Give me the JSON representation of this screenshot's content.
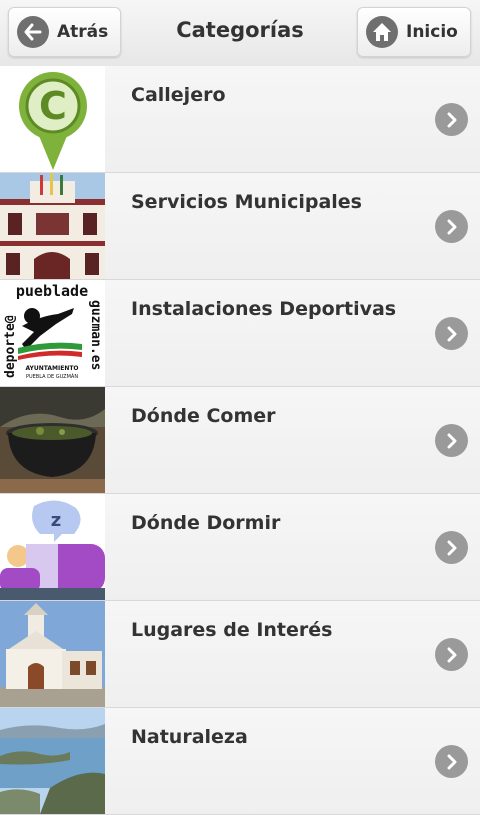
{
  "header": {
    "title": "Categorías",
    "back_label": "Atrás",
    "home_label": "Inicio"
  },
  "categories": [
    {
      "label": "Callejero",
      "icon": "callejero-logo"
    },
    {
      "label": "Servicios Municipales",
      "icon": "town-hall-photo"
    },
    {
      "label": "Instalaciones Deportivas",
      "icon": "deportes-logo"
    },
    {
      "label": "Dónde Comer",
      "icon": "cooking-pot-photo"
    },
    {
      "label": "Dónde Dormir",
      "icon": "sleeping-person-icon"
    },
    {
      "label": "Lugares de Interés",
      "icon": "church-photo"
    },
    {
      "label": "Naturaleza",
      "icon": "lake-landscape-photo"
    }
  ],
  "logo_text": {
    "callejero": "C",
    "deportes_top": "pueblade",
    "deportes_left": "deporte@",
    "deportes_right": "guzman.es",
    "deportes_footer_1": "AYUNTAMIENTO",
    "deportes_footer_2": "PUEBLA DE GUZMÁN"
  },
  "colors": {
    "accent_green": "#7fb23a",
    "arrow_gray": "#9a9a9a",
    "purple": "#a24bc4"
  }
}
